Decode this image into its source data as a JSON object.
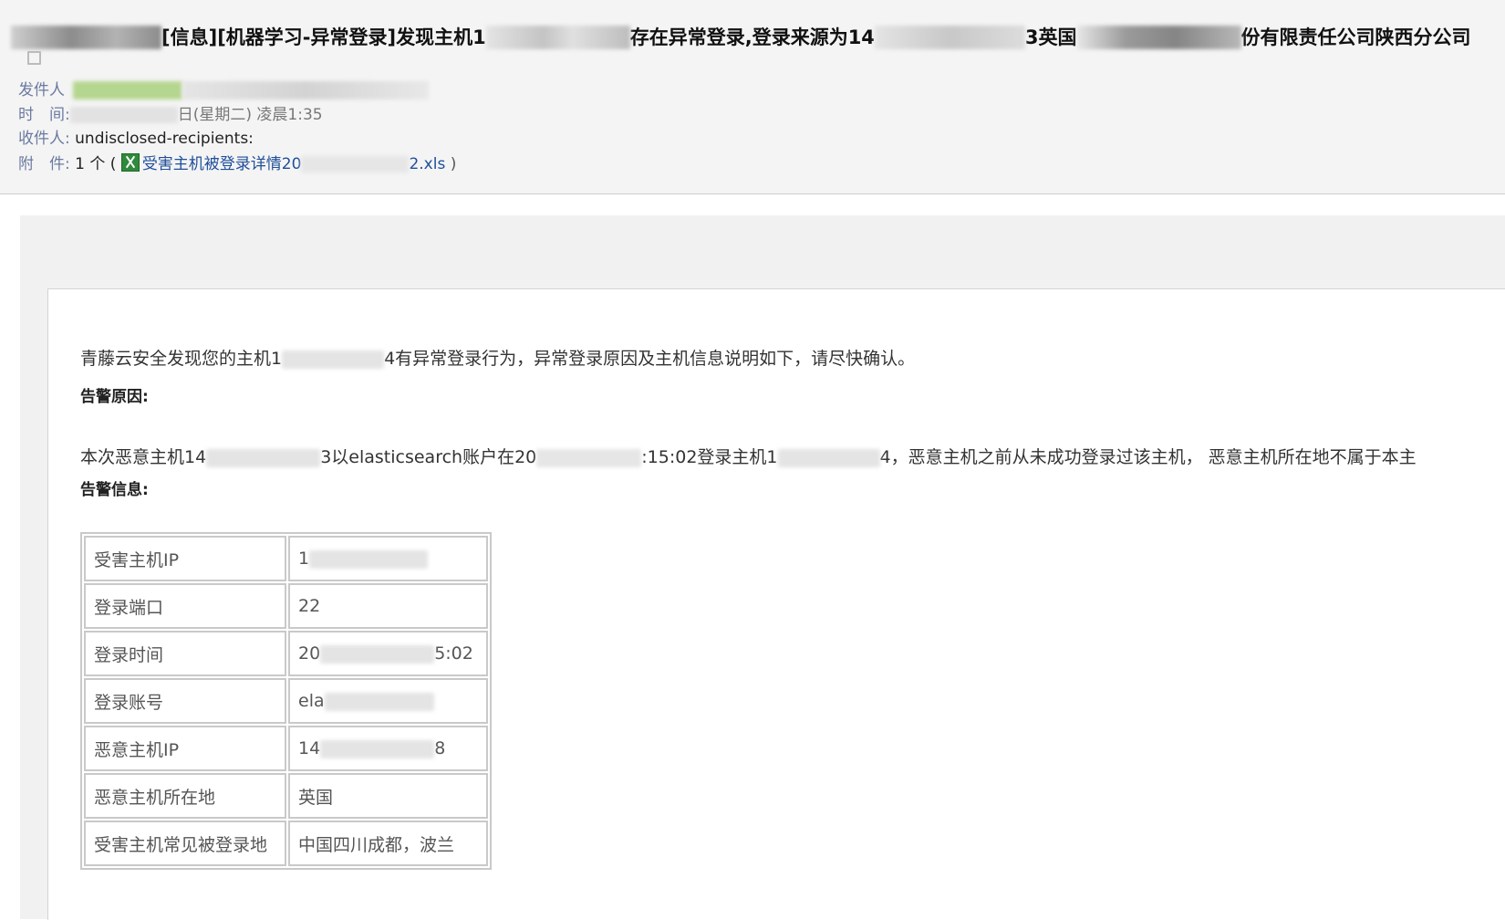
{
  "email": {
    "subject": {
      "part1": "[信息][机器学习-异常登录]发现主机1",
      "part2": "存在异常登录,登录来源为14",
      "part3": "3英国",
      "part4": "份有限责任公司陕西分公司"
    },
    "meta": {
      "from_label": "发件人",
      "time_label": "时　间:",
      "time_value": "日(星期二) 凌晨1:35",
      "to_label": "收件人:",
      "to_value": "undisclosed-recipients:",
      "attach_label": "附　件:",
      "attach_count": "1 个 (",
      "attach_file_prefix": "受害主机被登录详情20",
      "attach_file_suffix": "2.xls",
      "attach_close": ")",
      "attach_icon": "excel-file-icon"
    }
  },
  "alert": {
    "intro_prefix": "青藤云安全发现您的主机1",
    "intro_suffix": "4有异常登录行为，异常登录原因及主机信息说明如下，请尽快确认。",
    "reason_title": "告警原因:",
    "detail": {
      "p1": "本次恶意主机14",
      "p2": "3以elasticsearch账户在20",
      "p3": ":15:02登录主机1",
      "p4": "4，恶意主机之前从未成功登录过该主机，  恶意主机所在地不属于本主"
    },
    "info_title": "告警信息:",
    "table": [
      {
        "key": "受害主机IP",
        "value_prefix": "1",
        "value_suffix": ""
      },
      {
        "key": "登录端口",
        "value_prefix": "22",
        "value_suffix": ""
      },
      {
        "key": "登录时间",
        "value_prefix": "20",
        "value_suffix": "5:02"
      },
      {
        "key": "登录账号",
        "value_prefix": "ela",
        "value_suffix": ""
      },
      {
        "key": "恶意主机IP",
        "value_prefix": "14",
        "value_suffix": "8"
      },
      {
        "key": "恶意主机所在地",
        "value_prefix": "英国",
        "value_suffix": ""
      },
      {
        "key": "受害主机常见被登录地",
        "value_prefix": "中国四川成都，波兰",
        "value_suffix": ""
      }
    ]
  }
}
